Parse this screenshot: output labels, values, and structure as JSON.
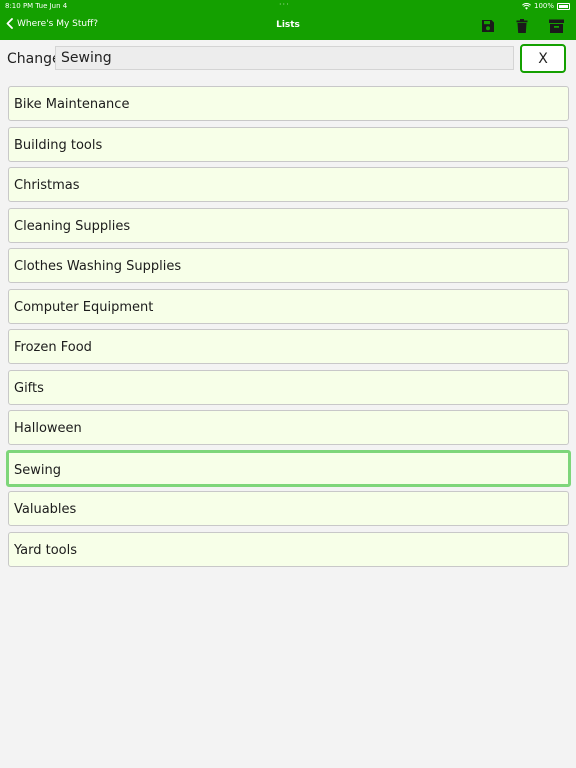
{
  "status_bar": {
    "time": "8:10 PM  Tue Jun 4",
    "dots": "···",
    "battery": "100%"
  },
  "nav": {
    "back_label": "Where's My Stuff?",
    "title": "Lists",
    "actions": [
      {
        "icon": "save-icon"
      },
      {
        "icon": "trash-icon"
      },
      {
        "icon": "archive-icon"
      }
    ]
  },
  "change": {
    "label": "Change",
    "value": "Sewing",
    "clear_label": "X"
  },
  "lists": [
    "Bike Maintenance",
    "Building tools",
    "Christmas",
    "Cleaning Supplies",
    "Clothes Washing Supplies",
    "Computer Equipment",
    "Frozen Food",
    "Gifts",
    "Halloween",
    "Sewing",
    "Valuables",
    "Yard tools"
  ],
  "selected": "Sewing",
  "colors": {
    "header": "#14a000",
    "item_bg": "#f7ffe8",
    "selected_border": "#7ed67a",
    "page_bg": "#f3f3f3"
  }
}
